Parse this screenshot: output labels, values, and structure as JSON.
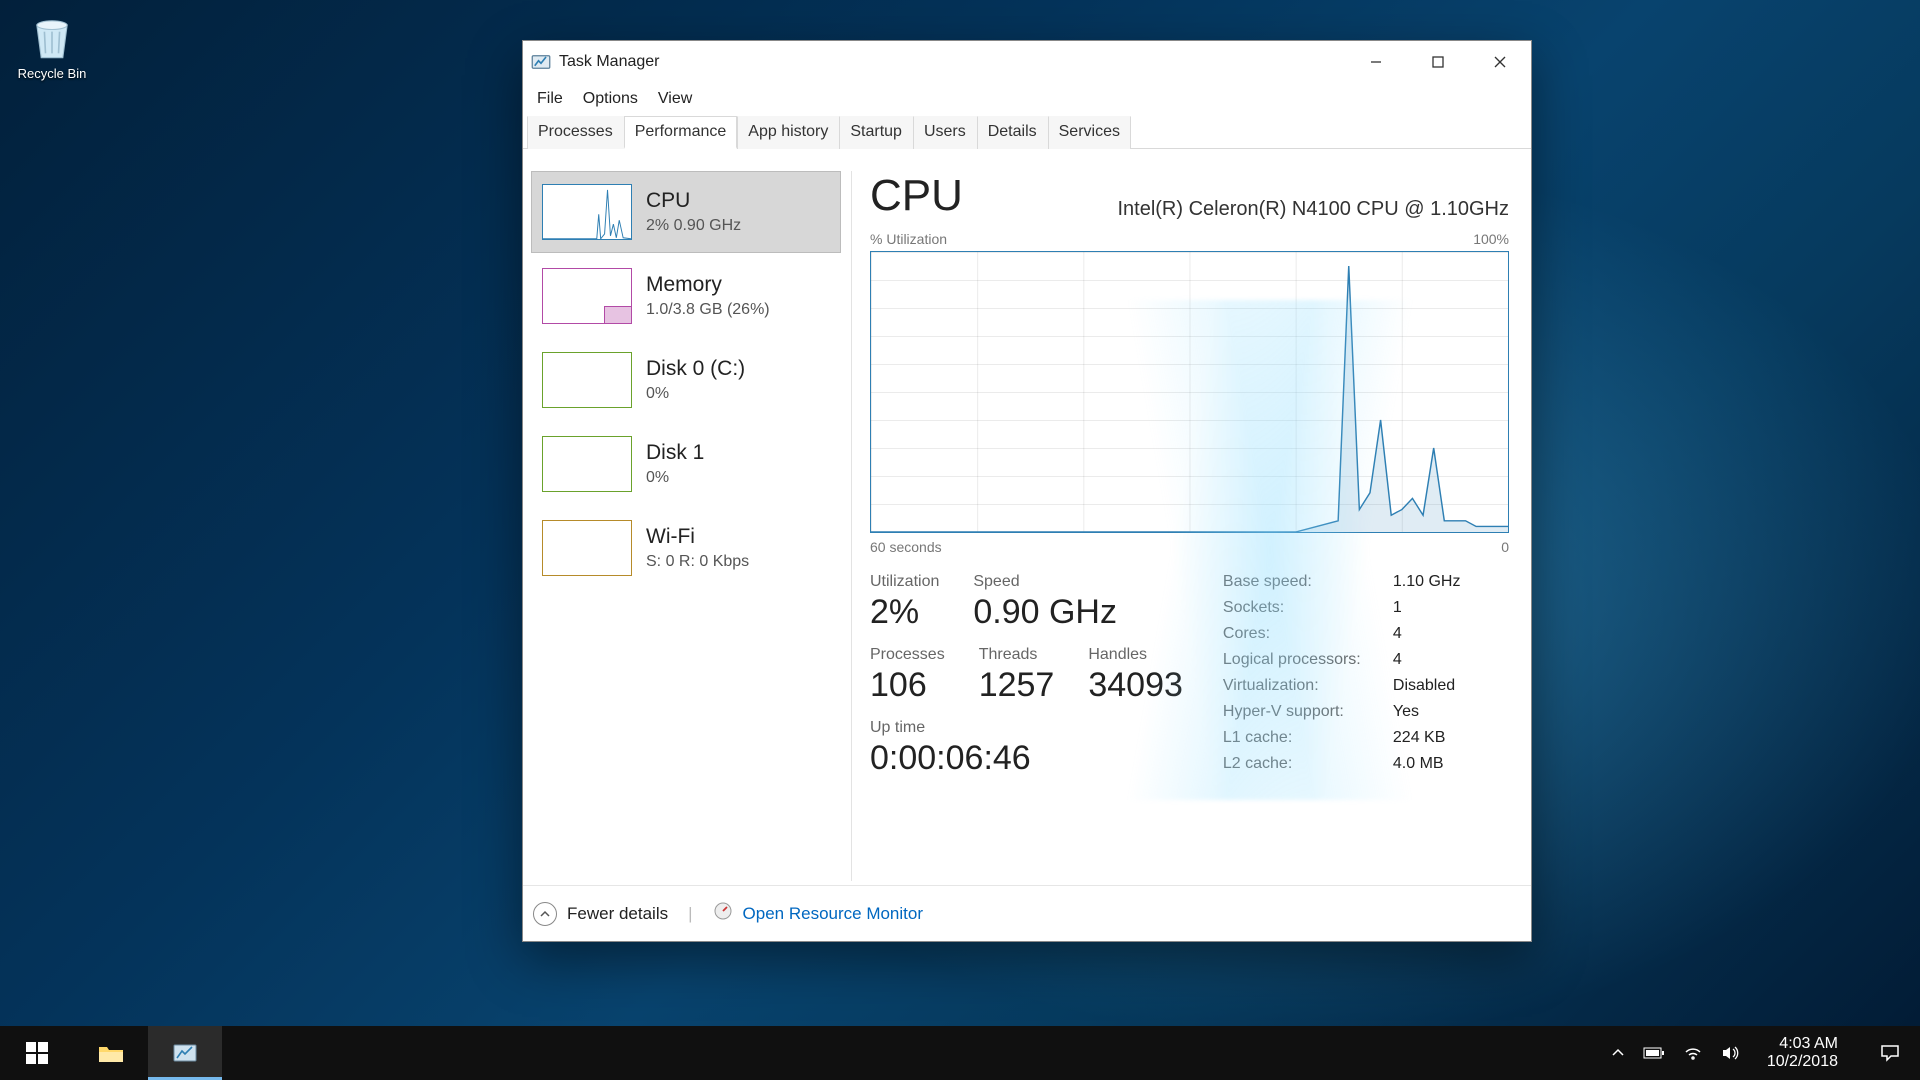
{
  "desktop": {
    "recycle_bin_label": "Recycle Bin"
  },
  "window": {
    "title": "Task Manager",
    "menu": {
      "file": "File",
      "options": "Options",
      "view": "View"
    },
    "tabs": {
      "processes": "Processes",
      "performance": "Performance",
      "app_history": "App history",
      "startup": "Startup",
      "users": "Users",
      "details": "Details",
      "services": "Services"
    },
    "sidebar": {
      "cpu": {
        "title": "CPU",
        "sub": "2%  0.90 GHz"
      },
      "memory": {
        "title": "Memory",
        "sub": "1.0/3.8 GB (26%)"
      },
      "disk0": {
        "title": "Disk 0 (C:)",
        "sub": "0%"
      },
      "disk1": {
        "title": "Disk 1",
        "sub": "0%"
      },
      "wifi": {
        "title": "Wi-Fi",
        "sub": "S: 0  R: 0 Kbps"
      }
    },
    "main": {
      "heading": "CPU",
      "model": "Intel(R) Celeron(R) N4100 CPU @ 1.10GHz",
      "graph_top_left": "% Utilization",
      "graph_top_right": "100%",
      "graph_bot_left": "60 seconds",
      "graph_bot_right": "0",
      "stats": {
        "utilization_label": "Utilization",
        "utilization_value": "2%",
        "speed_label": "Speed",
        "speed_value": "0.90 GHz",
        "processes_label": "Processes",
        "processes_value": "106",
        "threads_label": "Threads",
        "threads_value": "1257",
        "handles_label": "Handles",
        "handles_value": "34093",
        "uptime_label": "Up time",
        "uptime_value": "0:00:06:46"
      },
      "info": {
        "base_speed_k": "Base speed:",
        "base_speed_v": "1.10 GHz",
        "sockets_k": "Sockets:",
        "sockets_v": "1",
        "cores_k": "Cores:",
        "cores_v": "4",
        "logical_k": "Logical processors:",
        "logical_v": "4",
        "virt_k": "Virtualization:",
        "virt_v": "Disabled",
        "hyperv_k": "Hyper-V support:",
        "hyperv_v": "Yes",
        "l1_k": "L1 cache:",
        "l1_v": "224 KB",
        "l2_k": "L2 cache:",
        "l2_v": "4.0 MB"
      }
    },
    "footer": {
      "fewer_details": "Fewer details",
      "resource_monitor": "Open Resource Monitor"
    }
  },
  "taskbar": {
    "time": "4:03 AM",
    "date": "10/2/2018"
  },
  "chart_data": {
    "type": "line",
    "title": "CPU % Utilization",
    "xlabel": "seconds ago",
    "ylabel": "% Utilization",
    "ylim": [
      0,
      100
    ],
    "xlim_seconds": [
      60,
      0
    ],
    "x_seconds_ago": [
      60,
      58,
      56,
      54,
      52,
      50,
      48,
      46,
      44,
      42,
      40,
      38,
      36,
      34,
      32,
      30,
      28,
      26,
      24,
      22,
      20,
      18,
      16,
      15,
      14,
      13,
      12,
      11,
      10,
      9,
      8,
      7,
      6,
      5,
      4,
      3,
      2,
      1,
      0
    ],
    "values_percent": [
      0,
      0,
      0,
      0,
      0,
      0,
      0,
      0,
      0,
      0,
      0,
      0,
      0,
      0,
      0,
      0,
      0,
      0,
      0,
      0,
      0,
      2,
      4,
      95,
      8,
      14,
      40,
      6,
      8,
      12,
      6,
      30,
      4,
      4,
      4,
      2,
      2,
      2,
      2
    ]
  }
}
